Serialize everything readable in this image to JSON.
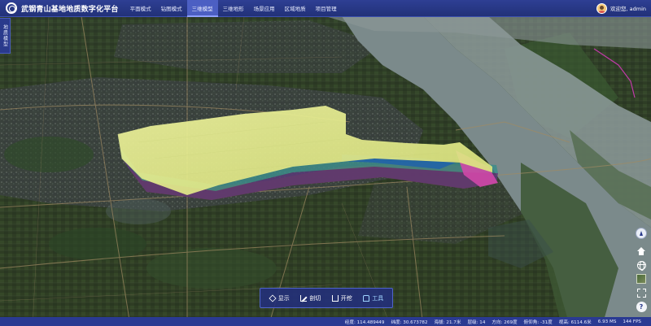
{
  "app": {
    "title": "武钢青山基地地质数字化平台"
  },
  "nav": {
    "items": [
      {
        "label": "平面模式",
        "active": false
      },
      {
        "label": "钻图模式",
        "active": false
      },
      {
        "label": "三维模型",
        "active": true
      },
      {
        "label": "三维地形",
        "active": false
      },
      {
        "label": "场景应用",
        "active": false
      },
      {
        "label": "区域地质",
        "active": false
      },
      {
        "label": "项目管理",
        "active": false
      }
    ]
  },
  "user": {
    "welcome": "欢迎您, admin"
  },
  "side_tab": {
    "label": "地质模型"
  },
  "right_tools": {
    "icons": [
      "compass-icon",
      "home-icon",
      "globe-icon",
      "layer-thumbnail-icon",
      "fullscreen-icon",
      "help-icon"
    ],
    "help_label": "?"
  },
  "toolbar": {
    "show_label": "显示",
    "cut_label": "剖切",
    "dig_label": "开挖",
    "tool_label": "工具",
    "active": "工具"
  },
  "status": {
    "longitude": "经度: 114.489449",
    "latitude": "纬度: 30.673782",
    "altitude": "海拔: 21.7米",
    "level": "层级: 14",
    "heading": "方向: 269度",
    "pitch": "俯仰角: -31度",
    "view_height": "视高: 6114.6米",
    "frame_time": "6.93 MS",
    "fps": "144 FPS"
  },
  "colors": {
    "topbar": "#2e3f94",
    "active_nav": "#4c5fc3",
    "model_top": "#e9f08c",
    "river": "#7e8b8c",
    "statusbar": "#2a3a92"
  }
}
